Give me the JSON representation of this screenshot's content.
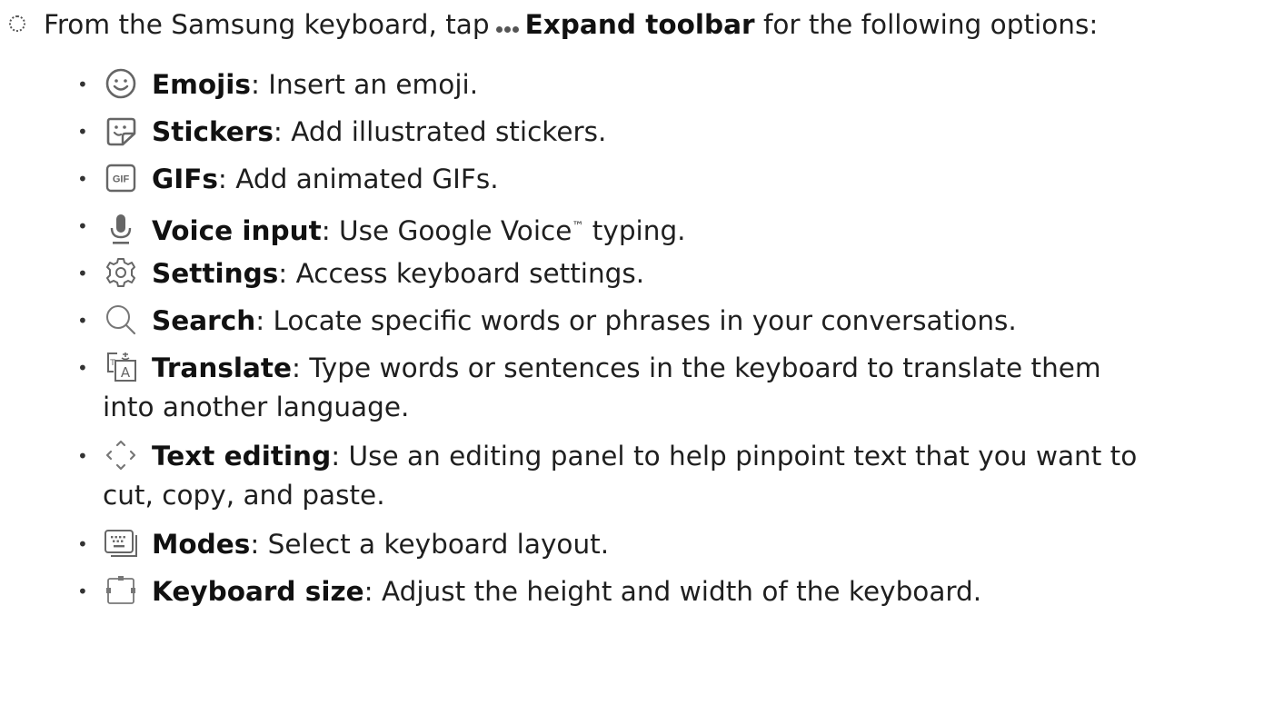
{
  "intro": {
    "before": "From the Samsung keyboard, tap",
    "strong": "Expand toolbar",
    "after": "for the following options:"
  },
  "items": [
    {
      "icon": "emoji-icon",
      "term": "Emojis",
      "desc": ": Insert an emoji.",
      "cont": ""
    },
    {
      "icon": "sticker-icon",
      "term": "Stickers",
      "desc": ": Add illustrated stickers.",
      "cont": ""
    },
    {
      "icon": "gif-icon",
      "icon_text": "GIF",
      "term": "GIFs",
      "desc": ": Add animated GIFs.",
      "cont": ""
    },
    {
      "icon": "microphone-icon",
      "term": "Voice input",
      "desc": ": Use Google Voice",
      "tm": "™",
      "desc2": " typing.",
      "cont": ""
    },
    {
      "icon": "gear-icon",
      "term": "Settings",
      "desc": ": Access keyboard settings.",
      "cont": ""
    },
    {
      "icon": "search-icon",
      "term": "Search",
      "desc": ": Locate specific words or phrases in your conversations.",
      "cont": ""
    },
    {
      "icon": "translate-icon",
      "term": "Translate",
      "desc": ": Type words or sentences in the keyboard to translate them",
      "cont": "into another language."
    },
    {
      "icon": "text-editing-icon",
      "term": "Text editing",
      "desc": ": Use an editing panel to help pinpoint text that you want to",
      "cont": "cut, copy, and paste."
    },
    {
      "icon": "keyboard-modes-icon",
      "term": "Modes",
      "desc": ": Select a keyboard layout.",
      "cont": ""
    },
    {
      "icon": "keyboard-size-icon",
      "term": "Keyboard size",
      "desc": ": Adjust the height and width of the keyboard.",
      "cont": ""
    }
  ]
}
